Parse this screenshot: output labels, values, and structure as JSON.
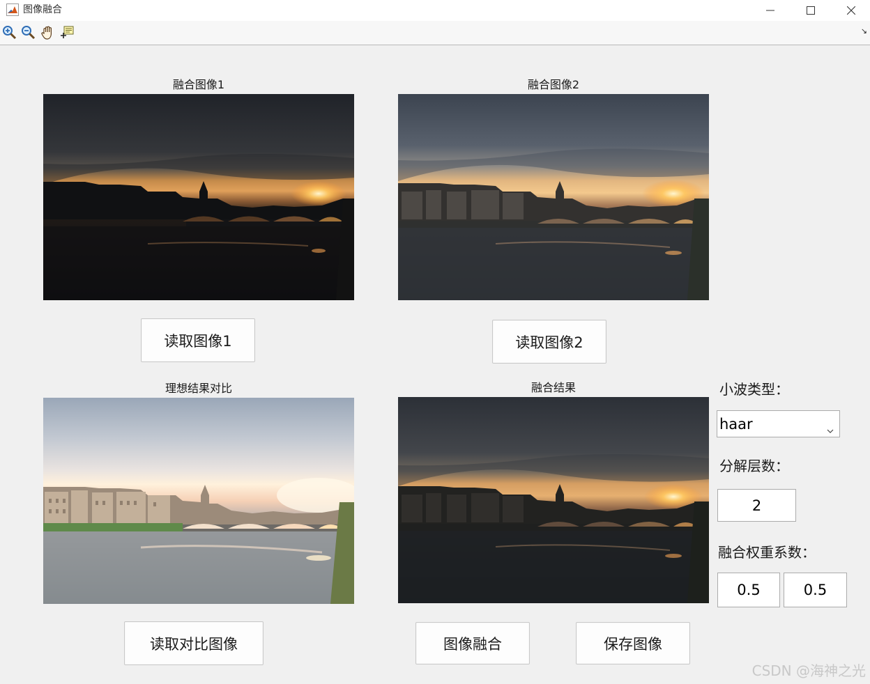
{
  "window": {
    "title": "图像融合"
  },
  "toolbar": {
    "tools": [
      "zoom-in-icon",
      "zoom-out-icon",
      "pan-icon",
      "data-cursor-icon"
    ],
    "arrow": "↘"
  },
  "axes": {
    "image1_title": "融合图像1",
    "image2_title": "融合图像2",
    "reference_title": "理想结果对比",
    "result_title": "融合结果"
  },
  "buttons": {
    "read_image1": "读取图像1",
    "read_image2": "读取图像2",
    "read_reference": "读取对比图像",
    "fuse": "图像融合",
    "save": "保存图像"
  },
  "params": {
    "wavelet_label": "小波类型：",
    "wavelet_value": "haar",
    "levels_label": "分解层数：",
    "levels_value": "2",
    "weights_label": "融合权重系数：",
    "weight1_value": "0.5",
    "weight2_value": "0.5"
  },
  "watermark": "CSDN @海神之光",
  "colors": {
    "window_bg": "#f0f0f0",
    "button_bg": "#fdfdfd",
    "edit_bg": "#ffffff"
  }
}
